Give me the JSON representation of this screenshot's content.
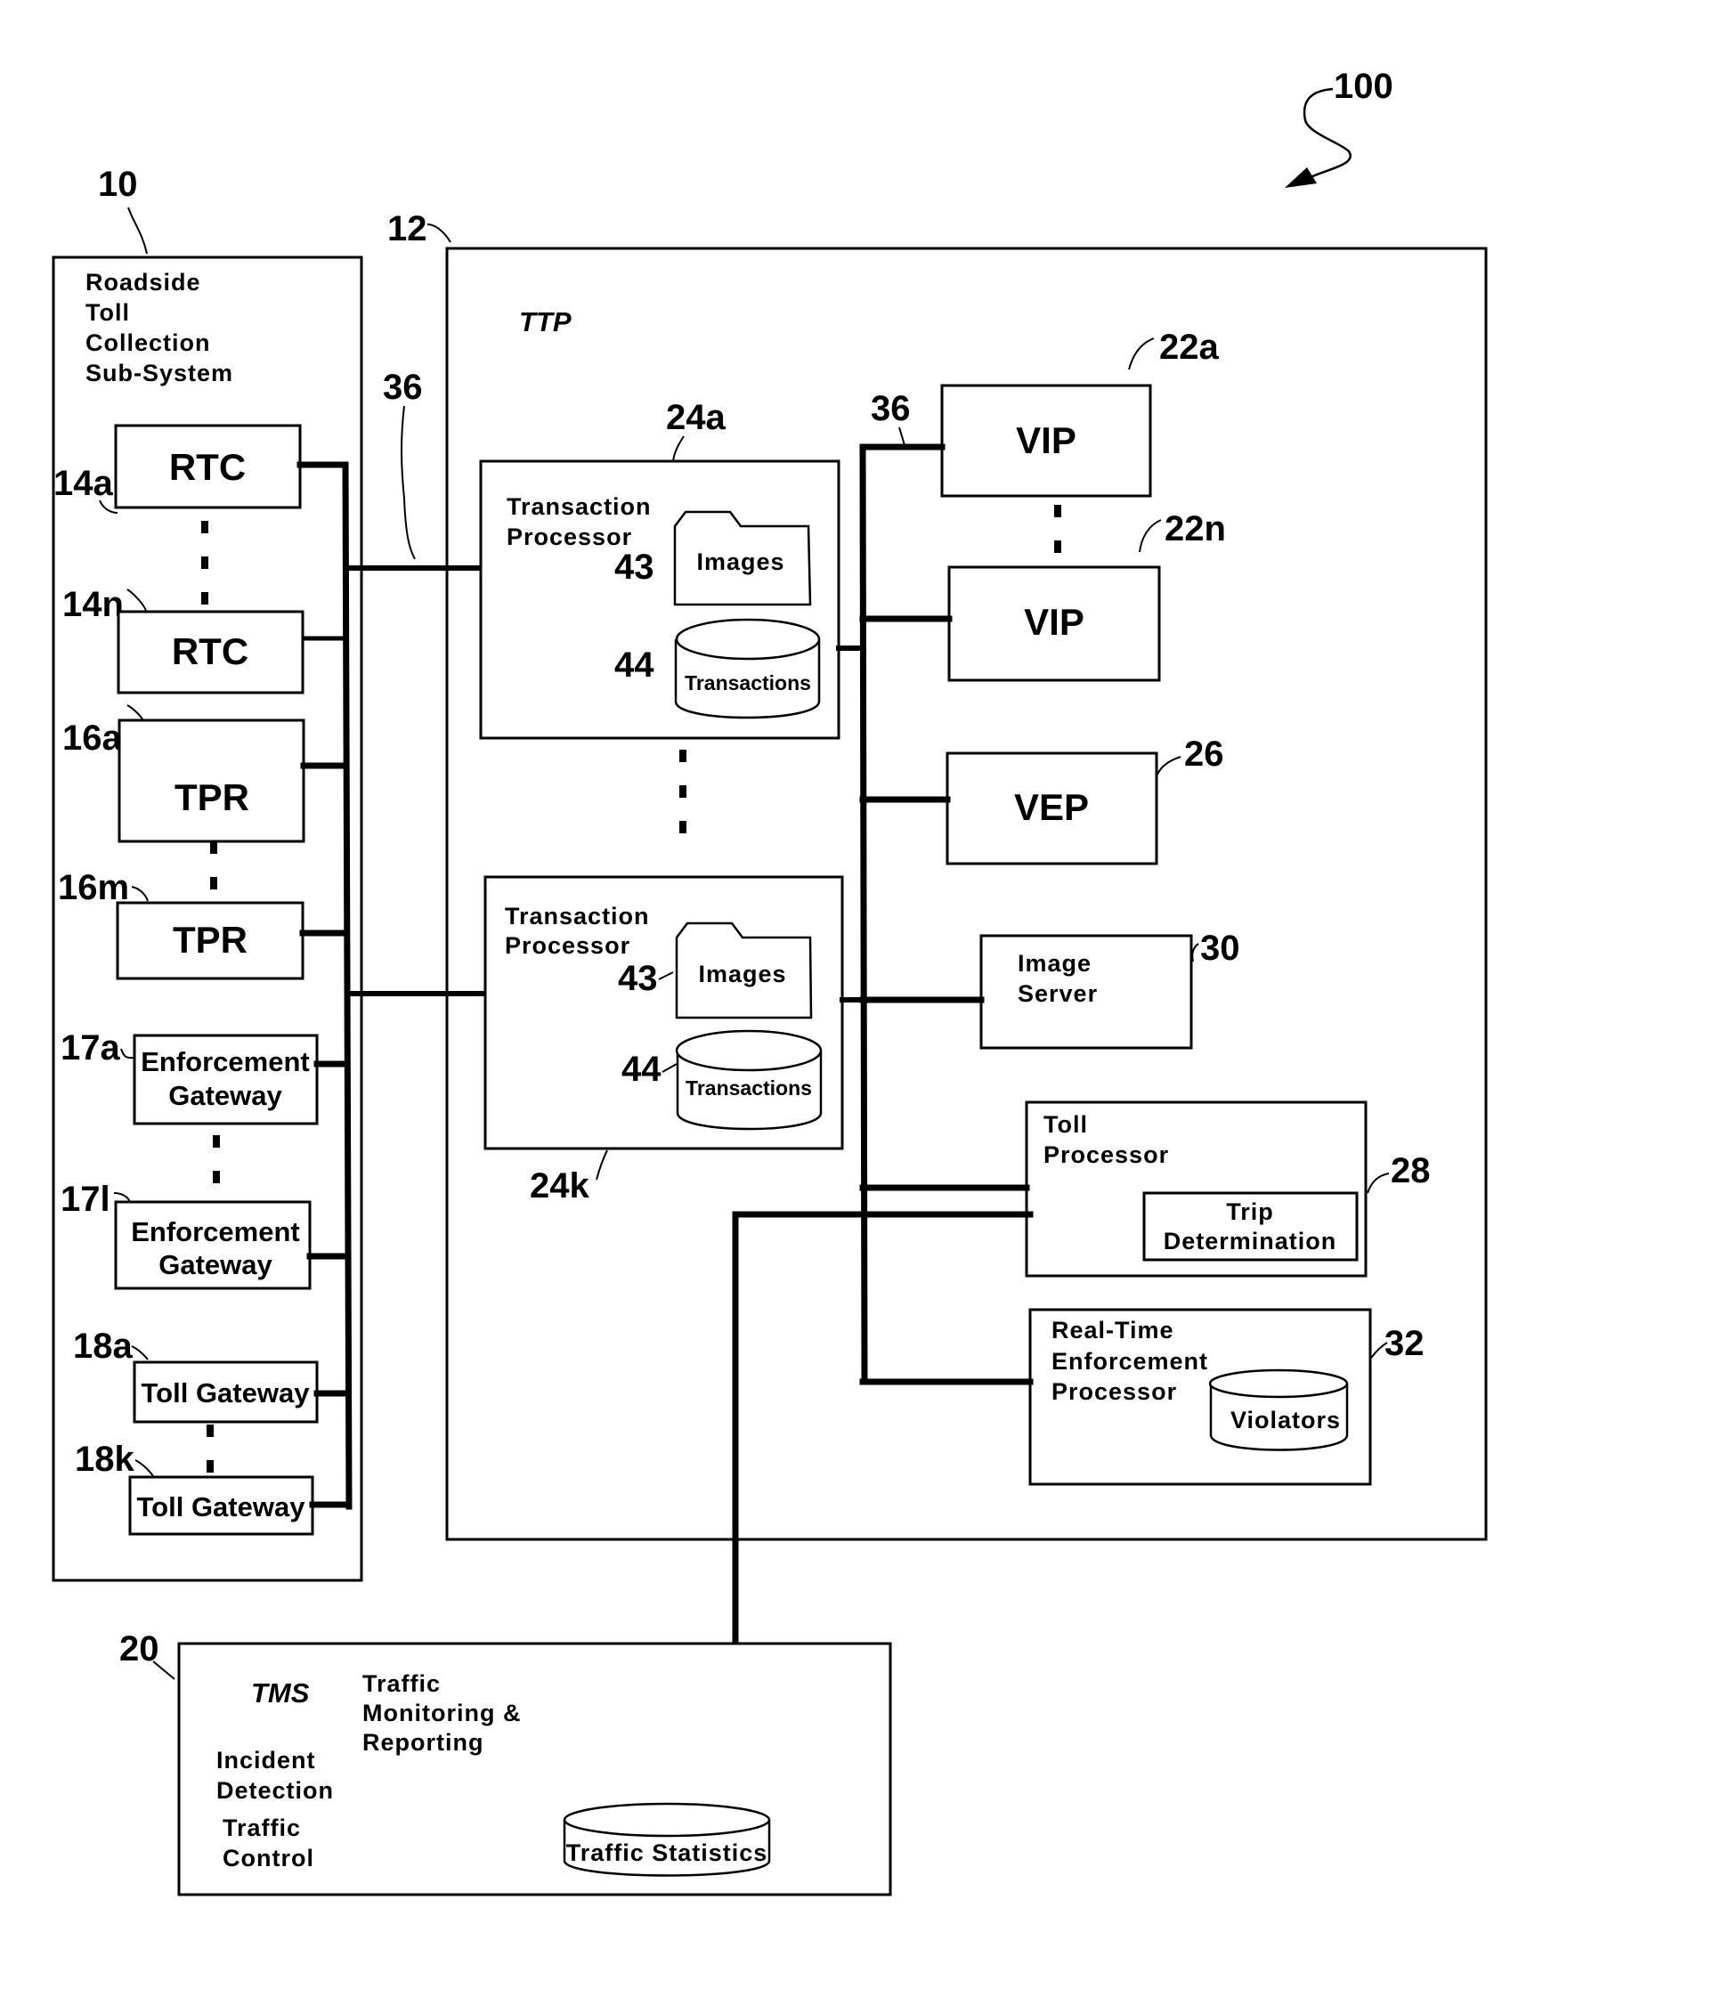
{
  "figure": {
    "ref": "100"
  },
  "roadside": {
    "ref": "10",
    "title_lines": [
      "Roadside",
      "Toll",
      "Collection",
      "Sub-System"
    ],
    "bus_ref": "36",
    "components": [
      {
        "ref": "14a",
        "label": "RTC"
      },
      {
        "ref": "14n",
        "label": "RTC"
      },
      {
        "ref": "16a",
        "label": "TPR"
      },
      {
        "ref": "16m",
        "label": "TPR"
      },
      {
        "ref": "17a",
        "label_lines": [
          "Enforcement",
          "Gateway"
        ]
      },
      {
        "ref": "17l",
        "label_lines": [
          "Enforcement",
          "Gateway"
        ]
      },
      {
        "ref": "18a",
        "label": "Toll Gateway"
      },
      {
        "ref": "18k",
        "label": "Toll Gateway"
      }
    ]
  },
  "ttp": {
    "ref": "12",
    "title": "TTP",
    "bus_ref": "36",
    "transaction_processors": [
      {
        "ref": "24a",
        "title_lines": [
          "Transaction",
          "Processor"
        ],
        "images_ref": "43",
        "images_label": "Images",
        "db_ref": "44",
        "db_label": "Transactions"
      },
      {
        "ref": "24k",
        "title_lines": [
          "Transaction",
          "Processor"
        ],
        "images_ref": "43",
        "images_label": "Images",
        "db_ref": "44",
        "db_label": "Transactions"
      }
    ],
    "vip": [
      {
        "ref": "22a",
        "label": "VIP"
      },
      {
        "ref": "22n",
        "label": "VIP"
      }
    ],
    "vep": {
      "ref": "26",
      "label": "VEP"
    },
    "image_server": {
      "ref": "30",
      "label_lines": [
        "Image",
        "Server"
      ]
    },
    "toll_processor": {
      "ref": "28",
      "label_lines": [
        "Toll",
        "Processor"
      ],
      "sub_lines": [
        "Trip",
        "Determination"
      ]
    },
    "rtep": {
      "ref": "32",
      "label_lines": [
        "Real-Time",
        "Enforcement",
        "Processor"
      ],
      "db_label": "Violators"
    }
  },
  "tms": {
    "ref": "20",
    "title": "TMS",
    "monitoring_lines": [
      "Traffic",
      "Monitoring &",
      "Reporting"
    ],
    "incident_lines": [
      "Incident",
      "Detection"
    ],
    "control_lines": [
      "Traffic",
      "Control"
    ],
    "db_label": "Traffic Statistics"
  }
}
